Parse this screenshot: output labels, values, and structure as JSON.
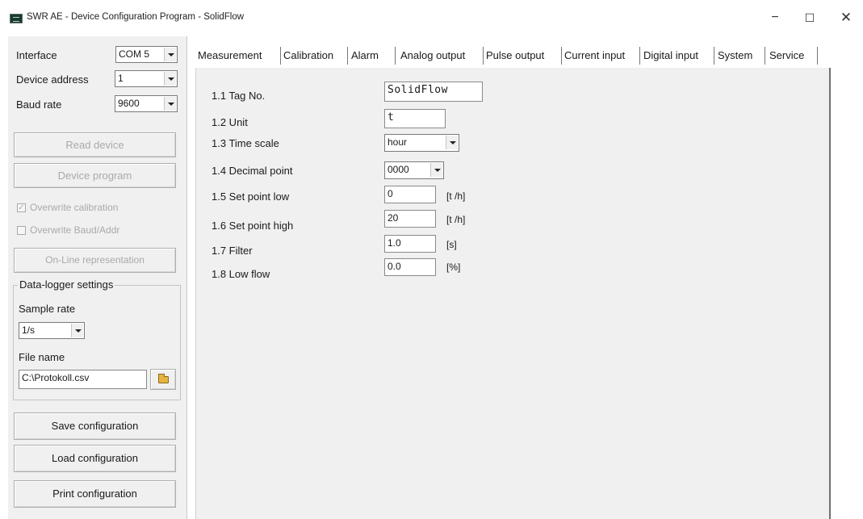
{
  "window": {
    "title": "SWR AE - Device Configuration Program - SolidFlow",
    "minimize_glyph": "−",
    "maximize_glyph": "☐",
    "close_glyph": "✕"
  },
  "left": {
    "interface_label": "Interface",
    "interface_value": "COM 5",
    "device_address_label": "Device address",
    "device_address_value": "1",
    "baud_rate_label": "Baud rate",
    "baud_rate_value": "9600",
    "read_device": "Read device",
    "device_program": "Device program",
    "overwrite_calibration": "Overwrite calibration",
    "overwrite_calibration_checked": "✓",
    "overwrite_baud": "Overwrite Baud/Addr",
    "online_representation": "On-Line representation",
    "datalogger_title": "Data-logger settings",
    "sample_rate_label": "Sample rate",
    "sample_rate_value": "1/s",
    "file_name_label": "File name",
    "file_name_value": "C:\\Protokoll.csv",
    "save_configuration": "Save configuration",
    "load_configuration": "Load configuration",
    "print_configuration": "Print configuration"
  },
  "tabs": [
    {
      "label": "Measurement"
    },
    {
      "label": "Calibration"
    },
    {
      "label": "Alarm"
    },
    {
      "label": "Analog output"
    },
    {
      "label": "Pulse output"
    },
    {
      "label": "Current input"
    },
    {
      "label": "Digital input"
    },
    {
      "label": "System"
    },
    {
      "label": "Service"
    }
  ],
  "measurement": {
    "tag_no_label": "1.1 Tag No.",
    "tag_no_value": "SolidFlow",
    "unit_label": "1.2 Unit",
    "unit_value": "t",
    "time_scale_label": "1.3 Time scale",
    "time_scale_value": "hour",
    "decimal_point_label": "1.4 Decimal point",
    "decimal_point_value": "0000",
    "set_point_low_label": "1.5 Set point low",
    "set_point_low_value": "0",
    "set_point_low_unit": "[t /h]",
    "set_point_high_label": "1.6 Set point high",
    "set_point_high_value": "20",
    "set_point_high_unit": "[t /h]",
    "filter_label": "1.7 Filter",
    "filter_value": "1.0",
    "filter_unit": "[s]",
    "low_flow_label": "1.8 Low flow",
    "low_flow_value": "0.0",
    "low_flow_unit": "[%]"
  }
}
